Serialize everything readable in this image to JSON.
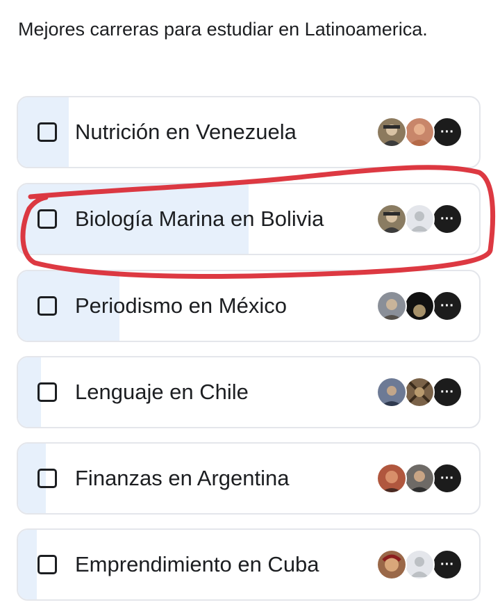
{
  "poll": {
    "question": "Mejores carreras para estudiar en Latinoamerica.",
    "options": [
      {
        "label": "Nutrición en Venezuela",
        "vote_fill": 0.11,
        "avatars": [
          "#8c7a5e",
          "#c8866a"
        ],
        "more": "···"
      },
      {
        "label": "Biología Marina en Bolivia",
        "vote_fill": 0.5,
        "avatars": [
          "#8a7c62",
          "#e4e6eb"
        ],
        "more": "···"
      },
      {
        "label": "Periodismo en México",
        "vote_fill": 0.22,
        "avatars": [
          "#8a8f98",
          "#5a4a30"
        ],
        "more": "···"
      },
      {
        "label": "Lenguaje en Chile",
        "vote_fill": 0.05,
        "avatars": [
          "#6d7a95",
          "#7a6248"
        ],
        "more": "···"
      },
      {
        "label": "Finanzas en Argentina",
        "vote_fill": 0.06,
        "avatars": [
          "#b0573e",
          "#6e6a66"
        ],
        "more": "···"
      },
      {
        "label": "Emprendimiento en Cuba",
        "vote_fill": 0.04,
        "avatars": [
          "#9a6848",
          "#e4e6eb"
        ],
        "more": "···"
      }
    ]
  },
  "colors": {
    "fill": "#e7f0fb",
    "border": "#e4e6eb",
    "text": "#1c1e21",
    "annotation_stroke": "#d9242e"
  }
}
